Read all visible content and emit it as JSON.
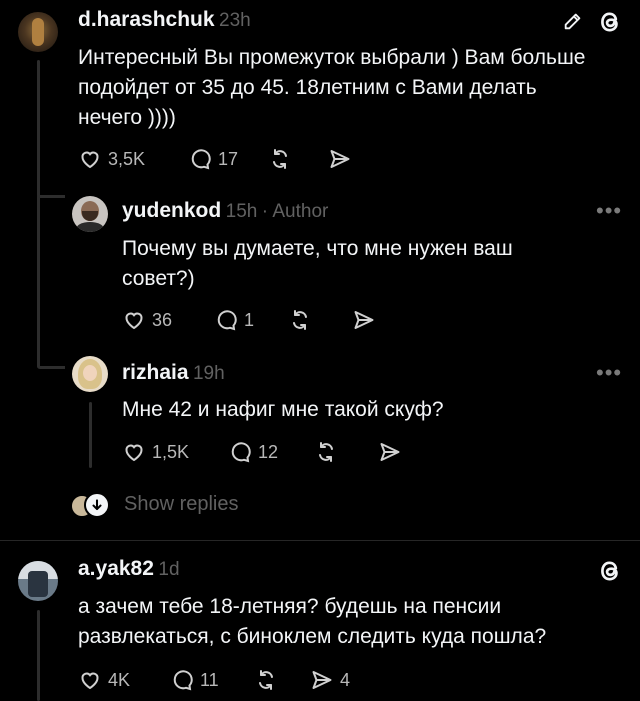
{
  "comments": [
    {
      "username": "d.harashchuk",
      "time": "23h",
      "text_lines": [
        "Интересный Вы промежуток выбрали ) Вам больше",
        "подойдет от 35 до 45. 18летним с Вами делать",
        "нечего ))))"
      ],
      "likes": "3,5K",
      "replies": "17"
    },
    {
      "username": "yudenkod",
      "time": "15h",
      "author_badge": "· Author",
      "text_lines": [
        "Почему вы думаете, что мне нужен ваш",
        "совет?)"
      ],
      "likes": "36",
      "replies": "1"
    },
    {
      "username": "rizhaia",
      "time": "19h",
      "text_lines": [
        "Мне 42 и нафиг мне такой скуф?"
      ],
      "likes": "1,5K",
      "replies": "12"
    },
    {
      "username": "a.yak82",
      "time": "1d",
      "text_lines": [
        "а зачем тебе 18-летняя? будешь на пенсии",
        "развлекаться, с биноклем следить куда пошла?"
      ],
      "likes": "4K",
      "replies": "11",
      "shares": "4"
    }
  ],
  "show_replies_label": "Show replies",
  "more_label": "•••",
  "colors": {
    "background": "#000000",
    "text": "#f3f5f7",
    "muted": "#616161",
    "line": "#2d2d2d"
  },
  "icons": [
    "heart-icon",
    "comment-icon",
    "repost-icon",
    "share-icon",
    "edit-icon",
    "threads-icon"
  ]
}
